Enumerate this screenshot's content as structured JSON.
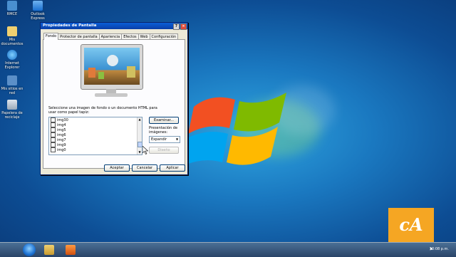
{
  "desktop": {
    "icons": [
      {
        "label": "RMCE",
        "name": "desktop-icon-rmce"
      },
      {
        "label": "Outlook Express",
        "name": "desktop-icon-outlook-express"
      },
      {
        "label": "Mis documentos",
        "name": "desktop-icon-mis-documentos"
      },
      {
        "label": "Internet Explorer",
        "name": "desktop-icon-internet-explorer"
      },
      {
        "label": "Mis sitios en red",
        "name": "desktop-icon-mis-sitios-en-red"
      },
      {
        "label": "Papelera de reciclaje",
        "name": "desktop-icon-papelera"
      }
    ]
  },
  "dialog": {
    "title": "Propiedades de Pantalla",
    "tabs": [
      "Fondo",
      "Protector de pantalla",
      "Apariencia",
      "Efectos",
      "Web",
      "Configuración"
    ],
    "active_tab": "Fondo",
    "instruction": "Seleccione una imagen de fondo o un documento HTML para usar como papel tapiz:",
    "files": [
      "img30",
      "img4",
      "img5",
      "img6",
      "img7",
      "img9",
      "img0"
    ],
    "browse_label": "Examinar...",
    "presentation_label": "Presentación de imágenes:",
    "presentation_value": "Expandir",
    "design_label": "Diseño",
    "ok_label": "Aceptar",
    "cancel_label": "Cancelar",
    "apply_label": "Aplicar"
  },
  "overlay": {
    "logo_text": "cA"
  },
  "taskbar": {
    "clock": "10:08 p.m."
  },
  "colors": {
    "accent": "#f5a623",
    "title_bar": "#0a4fc8"
  }
}
